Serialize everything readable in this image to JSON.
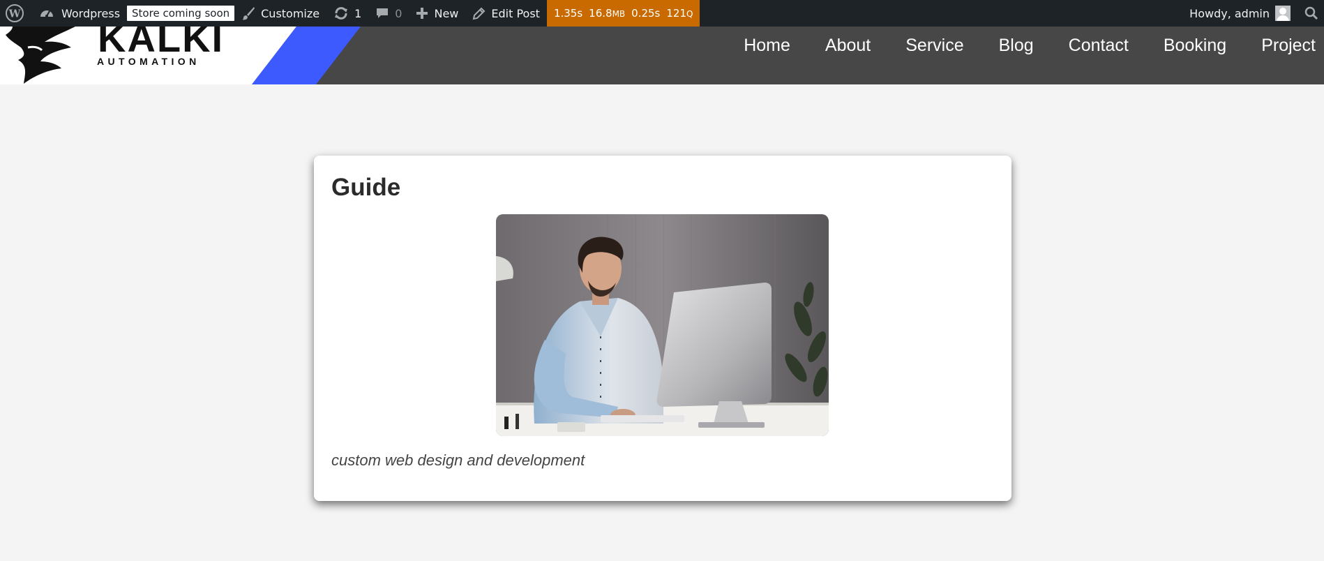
{
  "adminbar": {
    "site_name": "Wordpress",
    "store_badge": "Store coming soon",
    "customize": "Customize",
    "updates_count": "1",
    "comments_count": "0",
    "new_label": "New",
    "edit_post": "Edit Post",
    "perf": {
      "time": "1.35s",
      "memory": "16.8",
      "memory_unit": "MB",
      "query_time": "0.25s",
      "queries": "121",
      "queries_unit": "Q"
    },
    "howdy": "Howdy, admin"
  },
  "header": {
    "logo_text": "KALKI",
    "logo_subtext": "AUTOMATION",
    "nav": [
      "Home",
      "About",
      "Service",
      "Blog",
      "Contact",
      "Booking",
      "Project"
    ]
  },
  "card": {
    "title": "Guide",
    "image_alt": "Man working at a desktop computer",
    "caption": "custom web design and development"
  },
  "colors": {
    "adminbar_bg": "#1d2327",
    "perf_bg": "#c96a00",
    "header_bg": "#474747",
    "accent_blue": "#3d5afe",
    "page_bg": "#f4f4f4"
  }
}
